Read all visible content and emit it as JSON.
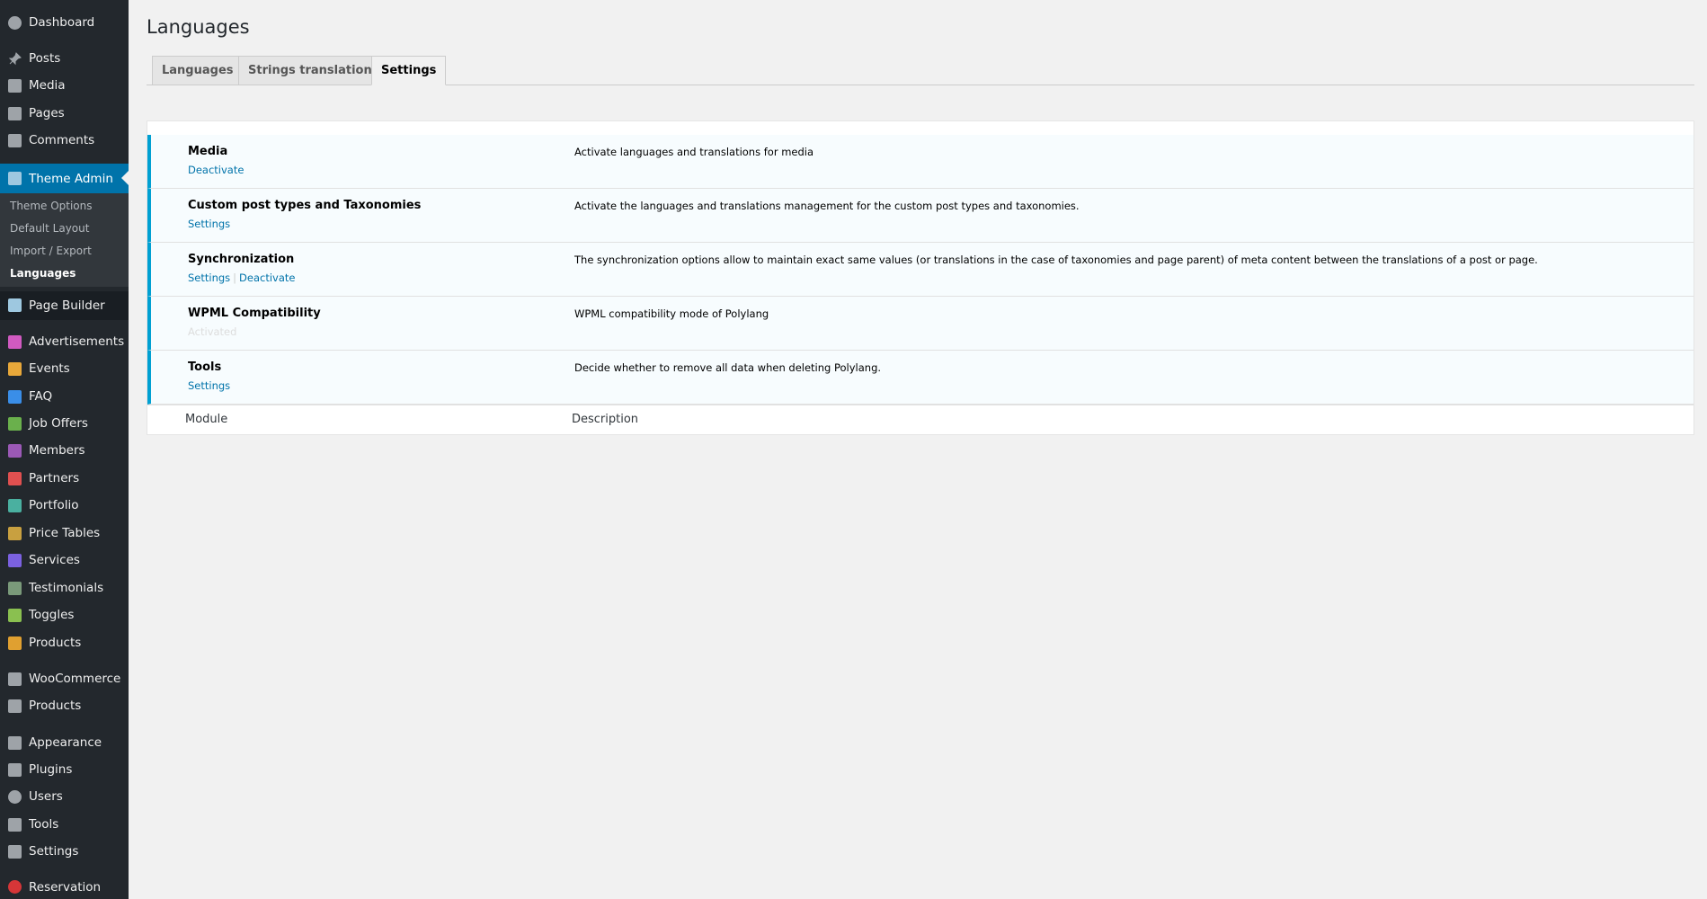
{
  "sidebar": {
    "items": [
      {
        "label": "Dashboard",
        "icon": "dashboard-icon",
        "color": "#9ea3a8"
      },
      {
        "label": "Posts",
        "icon": "pin-icon",
        "color": "#9ea3a8"
      },
      {
        "label": "Media",
        "icon": "media-icon",
        "color": "#9ea3a8"
      },
      {
        "label": "Pages",
        "icon": "pages-icon",
        "color": "#9ea3a8"
      },
      {
        "label": "Comments",
        "icon": "comment-icon",
        "color": "#9ea3a8"
      },
      {
        "label": "Theme Admin",
        "icon": "theme-admin-icon",
        "color": "#9ea3a8"
      },
      {
        "label": "Page Builder",
        "icon": "page-builder-icon",
        "color": "#9ea3a8"
      },
      {
        "label": "Advertisements",
        "icon": "advertisements-icon",
        "color": "#d05ac0"
      },
      {
        "label": "Events",
        "icon": "events-icon",
        "color": "#e8a83a"
      },
      {
        "label": "FAQ",
        "icon": "faq-icon",
        "color": "#3a8ee8"
      },
      {
        "label": "Job Offers",
        "icon": "job-offers-icon",
        "color": "#6ab04c"
      },
      {
        "label": "Members",
        "icon": "members-icon",
        "color": "#9b59b6"
      },
      {
        "label": "Partners",
        "icon": "partners-icon",
        "color": "#e05050"
      },
      {
        "label": "Portfolio",
        "icon": "portfolio-icon",
        "color": "#4ab0a0"
      },
      {
        "label": "Price Tables",
        "icon": "price-tables-icon",
        "color": "#c8a040"
      },
      {
        "label": "Services",
        "icon": "services-icon",
        "color": "#7b61e0"
      },
      {
        "label": "Testimonials",
        "icon": "testimonials-icon",
        "color": "#7a9a7a"
      },
      {
        "label": "Toggles",
        "icon": "toggles-icon",
        "color": "#8ac050"
      },
      {
        "label": "Products",
        "icon": "products-icon",
        "color": "#e0a030"
      },
      {
        "label": "WooCommerce",
        "icon": "woocommerce-icon",
        "color": "#9ea3a8"
      },
      {
        "label": "Products",
        "icon": "box-icon",
        "color": "#9ea3a8"
      },
      {
        "label": "Appearance",
        "icon": "appearance-icon",
        "color": "#9ea3a8"
      },
      {
        "label": "Plugins",
        "icon": "plugins-icon",
        "color": "#9ea3a8"
      },
      {
        "label": "Users",
        "icon": "users-icon",
        "color": "#9ea3a8"
      },
      {
        "label": "Tools",
        "icon": "tools-icon",
        "color": "#9ea3a8"
      },
      {
        "label": "Settings",
        "icon": "settings-icon",
        "color": "#9ea3a8"
      },
      {
        "label": "Reservation",
        "icon": "reservation-icon",
        "color": "#d63638"
      }
    ],
    "submenu": [
      "Theme Options",
      "Default Layout",
      "Import / Export",
      "Languages"
    ]
  },
  "page": {
    "title": "Languages",
    "tabs": [
      "Languages",
      "Strings translations",
      "Settings"
    ]
  },
  "modules": [
    {
      "name": "Media",
      "actions": [
        "Deactivate"
      ],
      "description": "Activate languages and translations for media"
    },
    {
      "name": "Custom post types and Taxonomies",
      "actions": [
        "Settings"
      ],
      "description": "Activate the languages and translations management for the custom post types and taxonomies."
    },
    {
      "name": "Synchronization",
      "actions": [
        "Settings",
        "Deactivate"
      ],
      "description": "The synchronization options allow to maintain exact same values (or translations in the case of taxonomies and page parent) of meta content between the translations of a post or page."
    },
    {
      "name": "WPML Compatibility",
      "status": "Activated",
      "description": "WPML compatibility mode of Polylang"
    },
    {
      "name": "Tools",
      "actions": [
        "Settings"
      ],
      "description": "Decide whether to remove all data when deleting Polylang."
    }
  ],
  "table_footer": {
    "module": "Module",
    "description": "Description"
  },
  "colors": {
    "accent": "#0073aa",
    "highlight_border": "#00a0d2",
    "sidebar_bg": "#23282d"
  }
}
